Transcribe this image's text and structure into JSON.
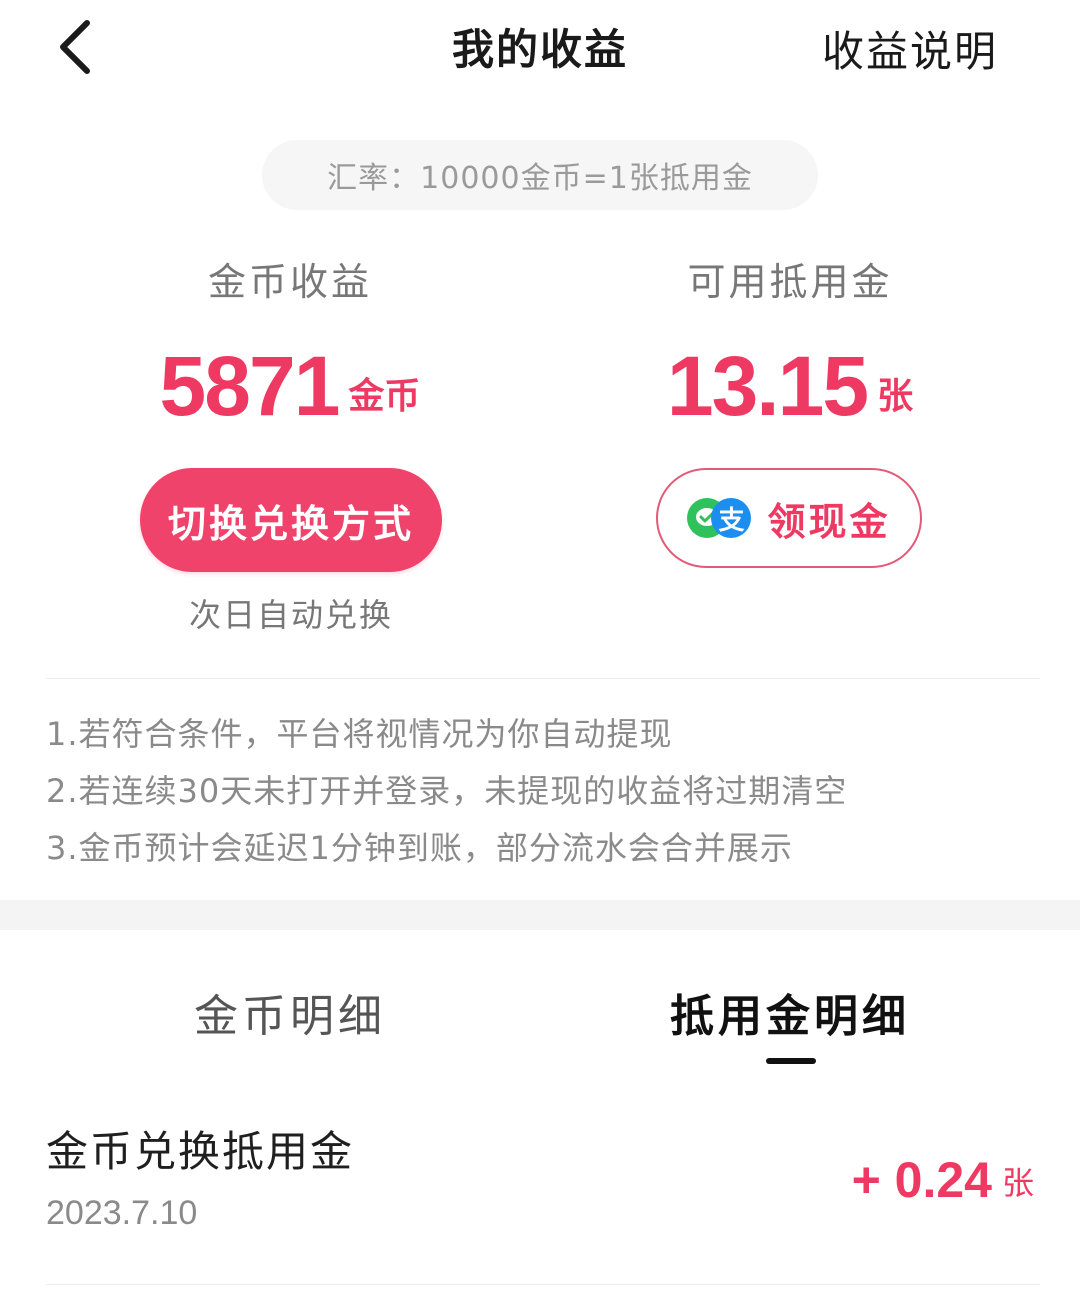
{
  "header": {
    "title": "我的收益",
    "explain_link": "收益说明"
  },
  "rate": {
    "text": "汇率：10000金币=1张抵用金"
  },
  "coins": {
    "label": "金币收益",
    "value": "5871",
    "unit": "金币",
    "switch_button": "切换兑换方式",
    "auto_note": "次日自动兑换"
  },
  "voucher": {
    "label": "可用抵用金",
    "value": "13.15",
    "unit": "张",
    "cash_button": "领现金",
    "alipay_glyph": "支"
  },
  "notes": [
    "1.若符合条件，平台将视情况为你自动提现",
    "2.若连续30天未打开并登录，未提现的收益将过期清空",
    "3.金币预计会延迟1分钟到账，部分流水会合并展示"
  ],
  "tabs": {
    "coins_detail": "金币明细",
    "voucher_detail": "抵用金明细",
    "active": "voucher_detail"
  },
  "records": [
    {
      "title": "金币兑换抵用金",
      "date": "2023.7.10",
      "amount": "+ 0.24",
      "unit": "张"
    }
  ],
  "colors": {
    "accent": "#ee3a63",
    "button_bg": "#f0436b",
    "wechat_green": "#2fc15b",
    "alipay_blue": "#1c8ef0"
  }
}
